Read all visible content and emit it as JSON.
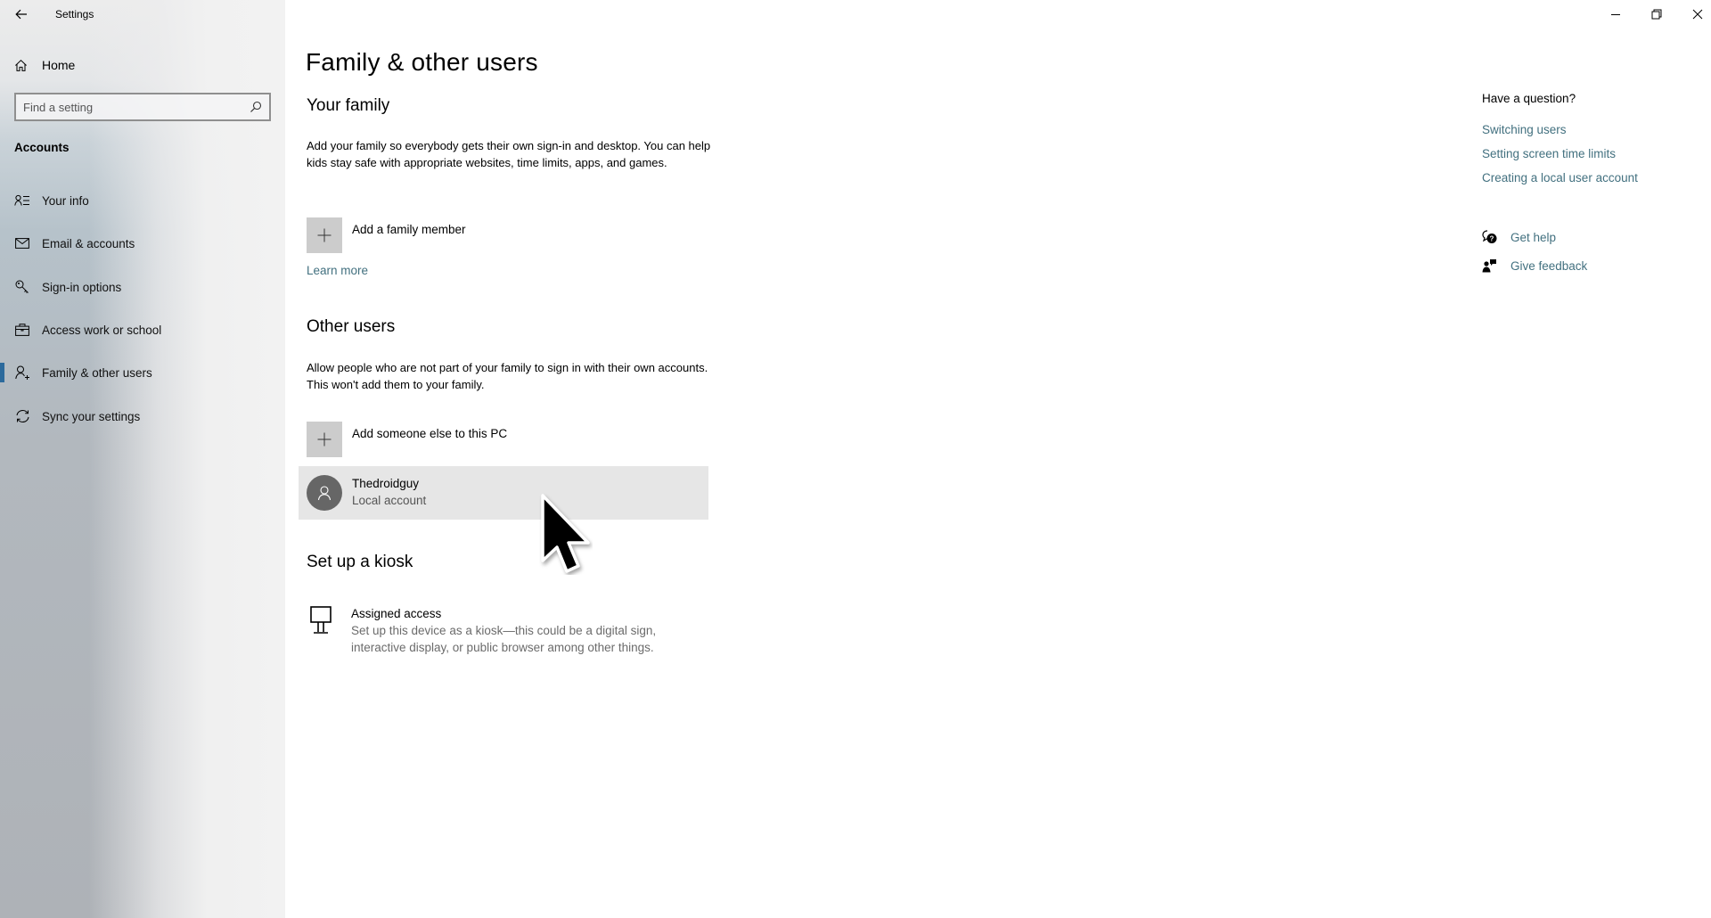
{
  "window": {
    "title": "Settings",
    "controls": {
      "minimize": "minimize",
      "restore": "restore",
      "close": "close"
    }
  },
  "sidebar": {
    "home_label": "Home",
    "search": {
      "placeholder": "Find a setting",
      "value": ""
    },
    "section_label": "Accounts",
    "items": [
      {
        "label": "Your info",
        "icon": "contact-info-icon",
        "selected": false
      },
      {
        "label": "Email & accounts",
        "icon": "mail-icon",
        "selected": false
      },
      {
        "label": "Sign-in options",
        "icon": "key-icon",
        "selected": false
      },
      {
        "label": "Access work or school",
        "icon": "briefcase-icon",
        "selected": false
      },
      {
        "label": "Family & other users",
        "icon": "add-person-icon",
        "selected": true
      },
      {
        "label": "Sync your settings",
        "icon": "sync-icon",
        "selected": false
      }
    ],
    "accent_color": "#2c6a9c"
  },
  "main": {
    "title": "Family & other users",
    "your_family": {
      "heading": "Your family",
      "description": "Add your family so everybody gets their own sign-in and desktop. You can help kids stay safe with appropriate websites, time limits, apps, and games.",
      "add_label": "Add a family member",
      "learn_more": "Learn more"
    },
    "other_users": {
      "heading": "Other users",
      "description": "Allow people who are not part of your family to sign in with their own accounts. This won't add them to your family.",
      "add_label": "Add someone else to this PC",
      "users": [
        {
          "name": "Thedroidguy",
          "type": "Local account"
        }
      ]
    },
    "kiosk": {
      "heading": "Set up a kiosk",
      "item_title": "Assigned access",
      "item_description": "Set up this device as a kiosk—this could be a digital sign, interactive display, or public browser among other things."
    }
  },
  "help_panel": {
    "title": "Have a question?",
    "links": [
      "Switching users",
      "Setting screen time limits",
      "Creating a local user account"
    ],
    "get_help": "Get help",
    "give_feedback": "Give feedback",
    "link_color": "#42707f"
  }
}
